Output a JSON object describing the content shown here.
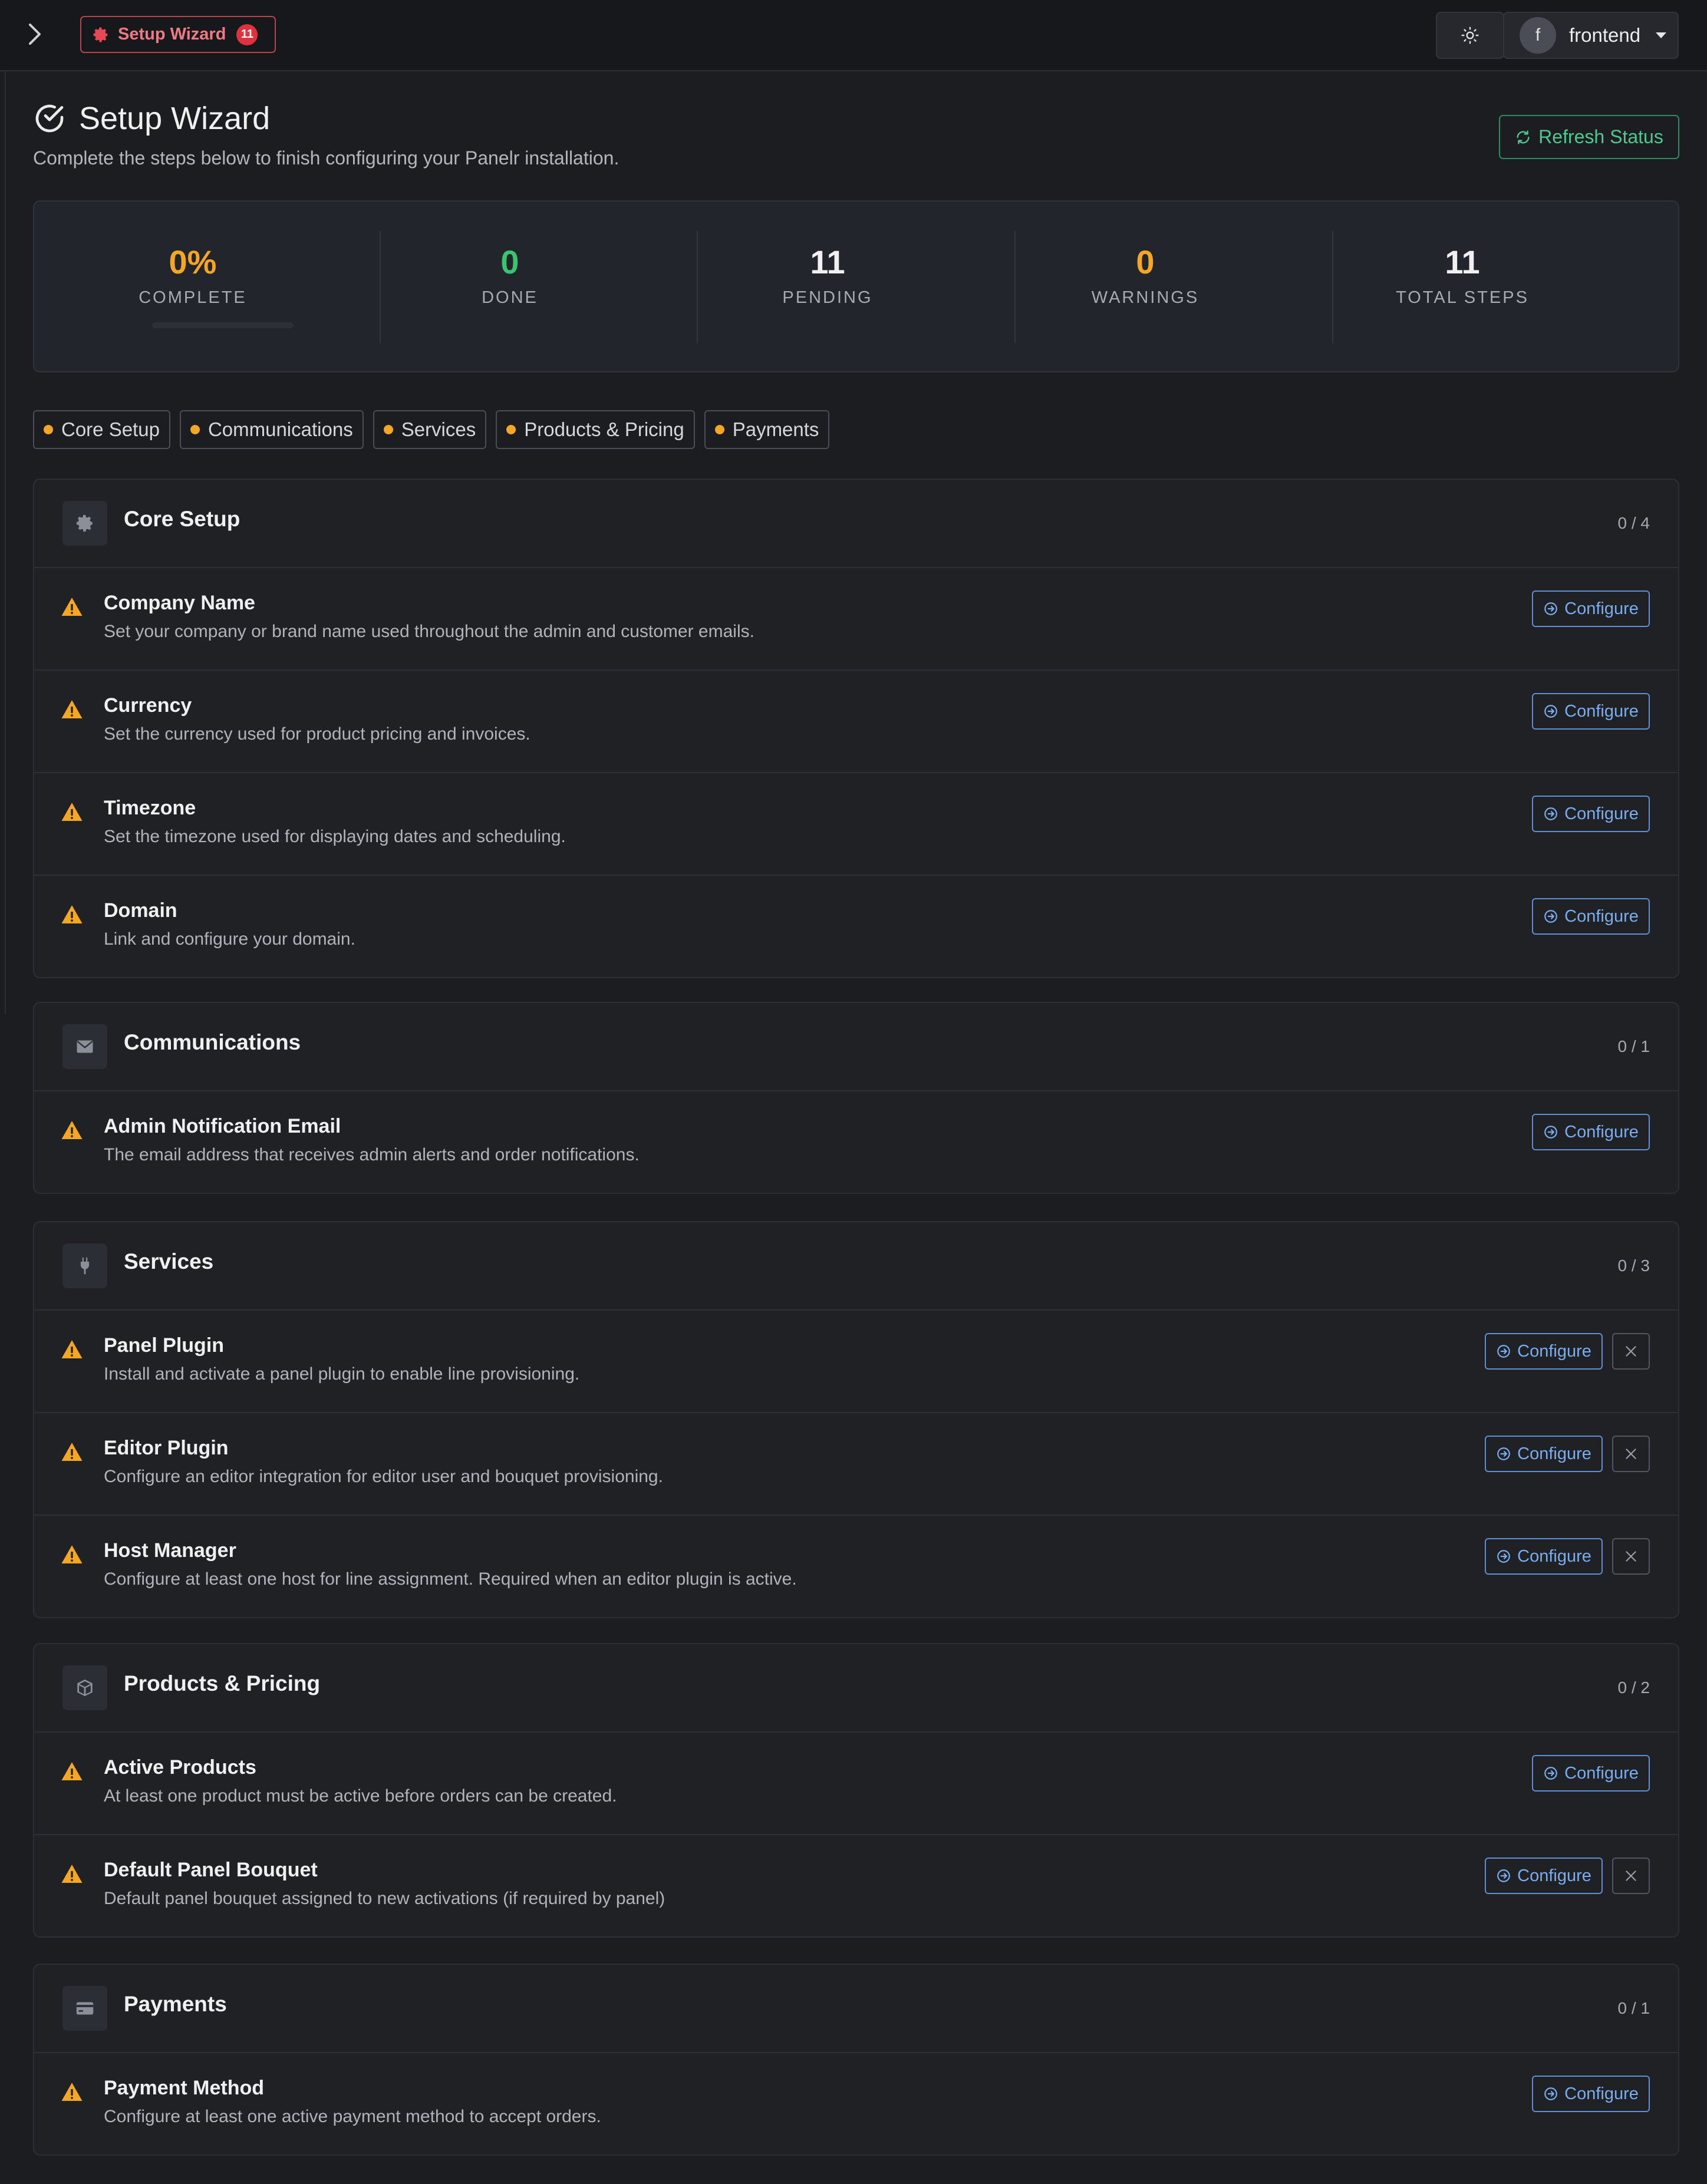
{
  "topbar": {
    "chip_label": "Setup Wizard",
    "chip_badge": "11",
    "user_initial": "f",
    "user_name": "frontend"
  },
  "header": {
    "title": "Setup Wizard",
    "subtitle": "Complete the steps below to finish configuring your Panelr installation.",
    "refresh_label": "Refresh Status"
  },
  "stats": {
    "complete": {
      "value": "0%",
      "label": "COMPLETE",
      "progress": 0
    },
    "done": {
      "value": "0",
      "label": "DONE"
    },
    "pending": {
      "value": "11",
      "label": "PENDING"
    },
    "warnings": {
      "value": "0",
      "label": "WARNINGS"
    },
    "total": {
      "value": "11",
      "label": "TOTAL STEPS"
    }
  },
  "tabs": [
    "Core Setup",
    "Communications",
    "Services",
    "Products & Pricing",
    "Payments"
  ],
  "colors": {
    "accent_orange": "#f5a623",
    "done_green": "#3ac46e",
    "configure_blue": "#78adf2",
    "refresh_green": "#4cc890",
    "chip_red": "#f07a84"
  },
  "sections": [
    {
      "title": "Core Setup",
      "count": "0 / 4",
      "icon": "gear-icon",
      "items": [
        {
          "title": "Company Name",
          "desc": "Set your company or brand name used throughout the admin and customer emails.",
          "action": "Configure",
          "dismissable": false
        },
        {
          "title": "Currency",
          "desc": "Set the currency used for product pricing and invoices.",
          "action": "Configure",
          "dismissable": false
        },
        {
          "title": "Timezone",
          "desc": "Set the timezone used for displaying dates and scheduling.",
          "action": "Configure",
          "dismissable": false
        },
        {
          "title": "Domain",
          "desc": "Link and configure your domain.",
          "action": "Configure",
          "dismissable": false
        }
      ]
    },
    {
      "title": "Communications",
      "count": "0 / 1",
      "icon": "envelope-icon",
      "items": [
        {
          "title": "Admin Notification Email",
          "desc": "The email address that receives admin alerts and order notifications.",
          "action": "Configure",
          "dismissable": false
        }
      ]
    },
    {
      "title": "Services",
      "count": "0 / 3",
      "icon": "plug-icon",
      "items": [
        {
          "title": "Panel Plugin",
          "desc": "Install and activate a panel plugin to enable line provisioning.",
          "action": "Configure",
          "dismissable": true
        },
        {
          "title": "Editor Plugin",
          "desc": "Configure an editor integration for editor user and bouquet provisioning.",
          "action": "Configure",
          "dismissable": true
        },
        {
          "title": "Host Manager",
          "desc": "Configure at least one host for line assignment. Required when an editor plugin is active.",
          "action": "Configure",
          "dismissable": true
        }
      ]
    },
    {
      "title": "Products & Pricing",
      "count": "0 / 2",
      "icon": "box-icon",
      "items": [
        {
          "title": "Active Products",
          "desc": "At least one product must be active before orders can be created.",
          "action": "Configure",
          "dismissable": false
        },
        {
          "title": "Default Panel Bouquet",
          "desc": "Default panel bouquet assigned to new activations (if required by panel)",
          "action": "Configure",
          "dismissable": true
        }
      ]
    },
    {
      "title": "Payments",
      "count": "0 / 1",
      "icon": "credit-card-icon",
      "items": [
        {
          "title": "Payment Method",
          "desc": "Configure at least one active payment method to accept orders.",
          "action": "Configure",
          "dismissable": false
        }
      ]
    }
  ]
}
